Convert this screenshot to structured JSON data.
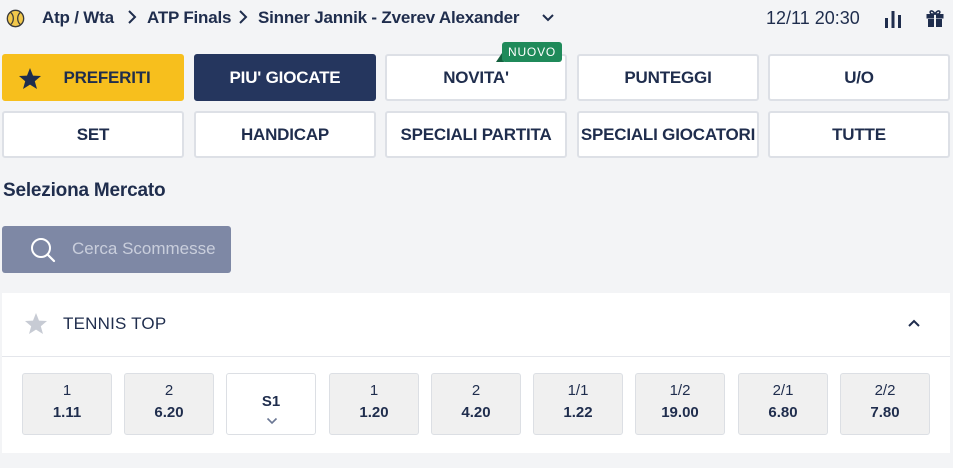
{
  "header": {
    "breadcrumbs": [
      "Atp / Wta",
      "ATP Finals",
      "Sinner Jannik - Zverev Alexander"
    ],
    "datetime": "12/11 20:30",
    "icons": [
      "tennis-ball-icon",
      "chevron-right-icon",
      "chevron-down-icon",
      "stats-icon",
      "gift-icon"
    ]
  },
  "markets": {
    "row1": [
      "PREFERITI",
      "PIU' GIOCATE",
      "NOVITA'",
      "PUNTEGGI",
      "U/O"
    ],
    "row2": [
      "SET",
      "HANDICAP",
      "SPECIALI PARTITA",
      "SPECIALI GIOCATORI",
      "TUTTE"
    ],
    "badge": "NUOVO"
  },
  "section_title": "Seleziona Mercato",
  "search": {
    "placeholder": "Cerca Scommesse",
    "value": ""
  },
  "panel": {
    "title": "TENNIS TOP",
    "odds": [
      {
        "label": "1",
        "value": "1.11"
      },
      {
        "label": "2",
        "value": "6.20"
      },
      {
        "label": "S1",
        "value": ""
      },
      {
        "label": "1",
        "value": "1.20"
      },
      {
        "label": "2",
        "value": "4.20"
      },
      {
        "label": "1/1",
        "value": "1.22"
      },
      {
        "label": "1/2",
        "value": "19.00"
      },
      {
        "label": "2/1",
        "value": "6.80"
      },
      {
        "label": "2/2",
        "value": "7.80"
      }
    ]
  },
  "colors": {
    "navy": "#25365e",
    "yellow": "#f7bf1d",
    "green_badge": "#1f8a5a",
    "search_bg": "#7e88a5",
    "background": "#f3f4f6"
  }
}
